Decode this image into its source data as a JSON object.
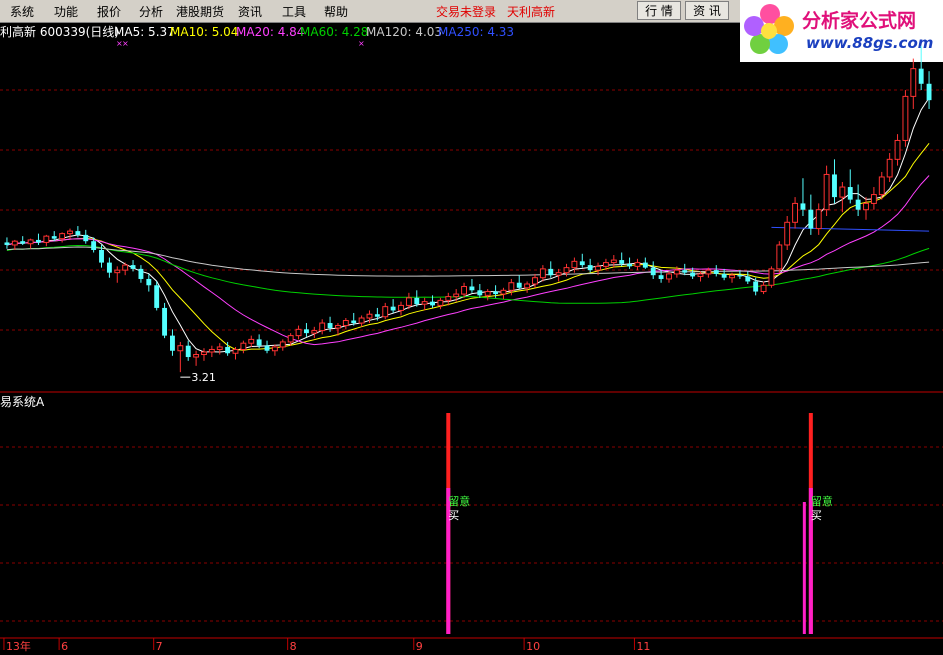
{
  "menu": {
    "items": [
      "系统",
      "功能",
      "报价",
      "分析",
      "港股期货",
      "资讯",
      "工具",
      "帮助"
    ],
    "login_status": "交易未登录",
    "stock_label": "天利高新",
    "quote_button": "行 情",
    "info_button": "资 讯"
  },
  "logo": {
    "title": "分析家公式网",
    "url": "www.88gs.com"
  },
  "colors": {
    "up_candle": "#ff3232",
    "down_candle": "#54ffff",
    "ma5": "#ffffff",
    "ma10": "#ffff00",
    "ma20": "#ff40ff",
    "ma60": "#00d000",
    "ma120": "#c8c8c8",
    "ma250": "#3050ff",
    "grid": "#8a0000",
    "signal_red": "#ff2020",
    "signal_magenta": "#ff20c8",
    "signal_text": "#40ff40"
  },
  "chart_data": [
    {
      "type": "candlestick",
      "title": "利高新 600339(日线)",
      "ma_legend": [
        {
          "name": "MA5",
          "value": 5.37,
          "label": "MA5: 5.37"
        },
        {
          "name": "MA10",
          "value": 5.04,
          "label": "MA10: 5.04"
        },
        {
          "name": "MA20",
          "value": 4.84,
          "label": "MA20: 4.84"
        },
        {
          "name": "MA60",
          "value": 4.28,
          "label": "MA60: 4.28"
        },
        {
          "name": "MA120",
          "value": 4.03,
          "label": "MA120: 4.03"
        },
        {
          "name": "MA250",
          "value": 4.33,
          "label": "MA250: 4.33"
        }
      ],
      "x_ticks": [
        "13年",
        "6",
        "7",
        "8",
        "9",
        "10",
        "11"
      ],
      "low_annotation": "3.21",
      "ylim": [
        3.1,
        5.8
      ],
      "grid": true,
      "candles": [
        [
          4.24,
          4.28,
          4.19,
          4.22
        ],
        [
          4.22,
          4.26,
          4.18,
          4.25
        ],
        [
          4.25,
          4.29,
          4.22,
          4.23
        ],
        [
          4.23,
          4.27,
          4.19,
          4.26
        ],
        [
          4.26,
          4.31,
          4.22,
          4.24
        ],
        [
          4.24,
          4.3,
          4.21,
          4.29
        ],
        [
          4.29,
          4.33,
          4.25,
          4.27
        ],
        [
          4.27,
          4.32,
          4.24,
          4.31
        ],
        [
          4.31,
          4.35,
          4.27,
          4.33
        ],
        [
          4.33,
          4.37,
          4.28,
          4.3
        ],
        [
          4.3,
          4.34,
          4.23,
          4.25
        ],
        [
          4.25,
          4.28,
          4.16,
          4.18
        ],
        [
          4.18,
          4.22,
          4.04,
          4.08
        ],
        [
          4.08,
          4.12,
          3.96,
          4.0
        ],
        [
          4.0,
          4.05,
          3.92,
          4.02
        ],
        [
          4.02,
          4.08,
          3.98,
          4.06
        ],
        [
          4.06,
          4.1,
          4.01,
          4.03
        ],
        [
          4.03,
          4.06,
          3.92,
          3.95
        ],
        [
          3.95,
          3.99,
          3.85,
          3.9
        ],
        [
          3.9,
          3.93,
          3.7,
          3.72
        ],
        [
          3.72,
          3.76,
          3.48,
          3.5
        ],
        [
          3.5,
          3.55,
          3.34,
          3.38
        ],
        [
          3.38,
          3.45,
          3.21,
          3.42
        ],
        [
          3.42,
          3.46,
          3.3,
          3.33
        ],
        [
          3.33,
          3.38,
          3.26,
          3.35
        ],
        [
          3.35,
          3.4,
          3.3,
          3.37
        ],
        [
          3.37,
          3.42,
          3.33,
          3.39
        ],
        [
          3.39,
          3.44,
          3.35,
          3.41
        ],
        [
          3.41,
          3.45,
          3.34,
          3.36
        ],
        [
          3.36,
          3.41,
          3.31,
          3.39
        ],
        [
          3.39,
          3.46,
          3.36,
          3.44
        ],
        [
          3.44,
          3.5,
          3.41,
          3.47
        ],
        [
          3.47,
          3.51,
          3.4,
          3.42
        ],
        [
          3.42,
          3.46,
          3.36,
          3.38
        ],
        [
          3.38,
          3.43,
          3.34,
          3.41
        ],
        [
          3.41,
          3.47,
          3.38,
          3.45
        ],
        [
          3.45,
          3.52,
          3.42,
          3.5
        ],
        [
          3.5,
          3.58,
          3.47,
          3.55
        ],
        [
          3.55,
          3.6,
          3.49,
          3.52
        ],
        [
          3.52,
          3.57,
          3.48,
          3.54
        ],
        [
          3.54,
          3.63,
          3.51,
          3.6
        ],
        [
          3.6,
          3.65,
          3.53,
          3.56
        ],
        [
          3.56,
          3.6,
          3.5,
          3.58
        ],
        [
          3.58,
          3.64,
          3.55,
          3.62
        ],
        [
          3.62,
          3.68,
          3.58,
          3.6
        ],
        [
          3.6,
          3.66,
          3.57,
          3.64
        ],
        [
          3.64,
          3.7,
          3.6,
          3.67
        ],
        [
          3.67,
          3.72,
          3.62,
          3.65
        ],
        [
          3.65,
          3.76,
          3.63,
          3.73
        ],
        [
          3.73,
          3.79,
          3.68,
          3.7
        ],
        [
          3.7,
          3.77,
          3.66,
          3.74
        ],
        [
          3.74,
          3.84,
          3.71,
          3.8
        ],
        [
          3.8,
          3.86,
          3.73,
          3.75
        ],
        [
          3.75,
          3.8,
          3.7,
          3.77
        ],
        [
          3.77,
          3.82,
          3.72,
          3.74
        ],
        [
          3.74,
          3.8,
          3.71,
          3.78
        ],
        [
          3.78,
          3.84,
          3.74,
          3.81
        ],
        [
          3.81,
          3.87,
          3.77,
          3.83
        ],
        [
          3.83,
          3.92,
          3.8,
          3.89
        ],
        [
          3.89,
          3.95,
          3.84,
          3.86
        ],
        [
          3.86,
          3.91,
          3.8,
          3.82
        ],
        [
          3.82,
          3.87,
          3.78,
          3.85
        ],
        [
          3.85,
          3.9,
          3.8,
          3.83
        ],
        [
          3.83,
          3.88,
          3.79,
          3.86
        ],
        [
          3.86,
          3.95,
          3.82,
          3.92
        ],
        [
          3.92,
          3.98,
          3.87,
          3.88
        ],
        [
          3.88,
          3.93,
          3.84,
          3.91
        ],
        [
          3.91,
          3.99,
          3.88,
          3.96
        ],
        [
          3.96,
          4.06,
          3.93,
          4.03
        ],
        [
          4.03,
          4.09,
          3.96,
          3.98
        ],
        [
          3.98,
          4.03,
          3.93,
          4.0
        ],
        [
          4.0,
          4.07,
          3.97,
          4.04
        ],
        [
          4.04,
          4.12,
          4.0,
          4.09
        ],
        [
          4.09,
          4.15,
          4.04,
          4.06
        ],
        [
          4.06,
          4.11,
          4.0,
          4.02
        ],
        [
          4.02,
          4.08,
          3.98,
          4.05
        ],
        [
          4.05,
          4.11,
          4.02,
          4.08
        ],
        [
          4.08,
          4.14,
          4.04,
          4.1
        ],
        [
          4.1,
          4.16,
          4.05,
          4.07
        ],
        [
          4.07,
          4.12,
          4.03,
          4.05
        ],
        [
          4.05,
          4.11,
          4.02,
          4.08
        ],
        [
          4.08,
          4.12,
          4.03,
          4.04
        ],
        [
          4.04,
          4.09,
          3.95,
          3.98
        ],
        [
          3.98,
          4.02,
          3.92,
          3.95
        ],
        [
          3.95,
          4.01,
          3.92,
          3.99
        ],
        [
          3.99,
          4.05,
          3.96,
          4.02
        ],
        [
          4.02,
          4.07,
          3.98,
          4.0
        ],
        [
          4.0,
          4.04,
          3.95,
          3.97
        ],
        [
          3.97,
          4.01,
          3.93,
          3.99
        ],
        [
          3.99,
          4.04,
          3.96,
          4.02
        ],
        [
          4.02,
          4.06,
          3.97,
          3.99
        ],
        [
          3.99,
          4.03,
          3.94,
          3.96
        ],
        [
          3.96,
          4.0,
          3.92,
          3.98
        ],
        [
          3.98,
          4.02,
          3.95,
          3.97
        ],
        [
          3.97,
          4.01,
          3.91,
          3.93
        ],
        [
          3.93,
          3.96,
          3.82,
          3.85
        ],
        [
          3.85,
          3.93,
          3.83,
          3.9
        ],
        [
          3.9,
          4.05,
          3.88,
          4.03
        ],
        [
          4.03,
          4.25,
          4.0,
          4.22
        ],
        [
          4.22,
          4.45,
          4.18,
          4.4
        ],
        [
          4.4,
          4.6,
          4.35,
          4.55
        ],
        [
          4.55,
          4.75,
          4.45,
          4.5
        ],
        [
          4.5,
          4.62,
          4.3,
          4.35
        ],
        [
          4.35,
          4.55,
          4.3,
          4.5
        ],
        [
          4.5,
          4.85,
          4.45,
          4.78
        ],
        [
          4.78,
          4.9,
          4.55,
          4.6
        ],
        [
          4.6,
          4.72,
          4.48,
          4.68
        ],
        [
          4.68,
          4.82,
          4.55,
          4.58
        ],
        [
          4.58,
          4.7,
          4.45,
          4.5
        ],
        [
          4.5,
          4.6,
          4.42,
          4.55
        ],
        [
          4.55,
          4.68,
          4.5,
          4.62
        ],
        [
          4.62,
          4.8,
          4.58,
          4.76
        ],
        [
          4.76,
          4.95,
          4.72,
          4.9
        ],
        [
          4.9,
          5.1,
          4.85,
          5.05
        ],
        [
          5.05,
          5.45,
          5.0,
          5.4
        ],
        [
          5.4,
          5.7,
          5.3,
          5.62
        ],
        [
          5.62,
          5.8,
          5.45,
          5.5
        ],
        [
          5.5,
          5.6,
          5.3,
          5.37
        ]
      ]
    },
    {
      "type": "bar",
      "title": "易系统A",
      "signals": [
        {
          "index": 56,
          "label_top": "留意",
          "label_bottom": "买"
        },
        {
          "index": 102,
          "label_top": "留意",
          "label_bottom": "买"
        }
      ]
    }
  ]
}
